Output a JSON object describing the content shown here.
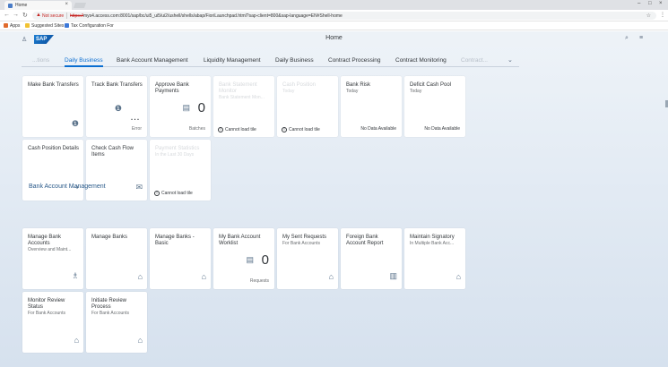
{
  "browser": {
    "tab_title": "Home",
    "not_secure": "Not secure",
    "url_host": "https://",
    "url_rest": "mys4.access.com:8001/sap/bc/ui5_ui5/ui2/ushell/shells/abap/FioriLaunchpad.html?sap-client=800&sap-language=EN#Shell-home",
    "bookmarks": [
      "Apps",
      "Suggested Sites",
      "Tax Configuration For"
    ]
  },
  "shell": {
    "logo": "SAP",
    "title": "Home"
  },
  "anchors": [
    {
      "label": "...tions",
      "state": "faded"
    },
    {
      "label": "Daily Business",
      "state": "selected"
    },
    {
      "label": "Bank Account Management",
      "state": "normal"
    },
    {
      "label": "Liquidity Management",
      "state": "normal"
    },
    {
      "label": "Daily Business",
      "state": "normal"
    },
    {
      "label": "Contract Processing",
      "state": "normal"
    },
    {
      "label": "Contract Monitoring",
      "state": "normal"
    },
    {
      "label": "Contract...",
      "state": "faded"
    }
  ],
  "tiles_daily": [
    {
      "title": "Make Bank Transfers"
    },
    {
      "title": "Track Bank Transfers",
      "status": "Error"
    },
    {
      "title": "Approve Bank Payments",
      "kpi": "0",
      "unit": "Batches"
    },
    {
      "title": "Bank Statement Monitor",
      "subtitle": "Bank Statement Mon...",
      "error": "Cannot load tile"
    },
    {
      "title": "Cash Position",
      "subtitle": "Today",
      "error": "Cannot load tile"
    },
    {
      "title": "Bank Risk",
      "subtitle": "Today",
      "status": "No Data Available"
    },
    {
      "title": "Deficit Cash Pool",
      "subtitle": "Today",
      "status": "No Data Available"
    },
    {
      "title": "Cash Position Details"
    },
    {
      "title": "Check Cash Flow Items"
    },
    {
      "title": "Payment Statistics",
      "subtitle": "In the Last 30 Days",
      "error": "Cannot load tile"
    }
  ],
  "section_bank": "Bank Account Management",
  "tiles_bank": [
    {
      "title": "Manage Bank Accounts",
      "subtitle": "Overview and Maint..."
    },
    {
      "title": "Manage Banks"
    },
    {
      "title": "Manage Banks - Basic"
    },
    {
      "title": "My Bank Account Worklist",
      "kpi": "0",
      "unit": "Requests"
    },
    {
      "title": "My Sent Requests",
      "subtitle": "For Bank Accounts"
    },
    {
      "title": "Foreign Bank Account Report"
    },
    {
      "title": "Maintain Signatory",
      "subtitle": "In Multiple Bank Acc..."
    },
    {
      "title": "Monitor Review Status",
      "subtitle": "For Bank Accounts"
    },
    {
      "title": "Initiate Review Process",
      "subtitle": "For Bank Accounts"
    }
  ],
  "icons": [
    "info-add-icon",
    "info-icon",
    "stack-icon",
    "alert-icon",
    "flow-icon",
    "envelope-icon",
    "bank-icon",
    "document-icon"
  ]
}
